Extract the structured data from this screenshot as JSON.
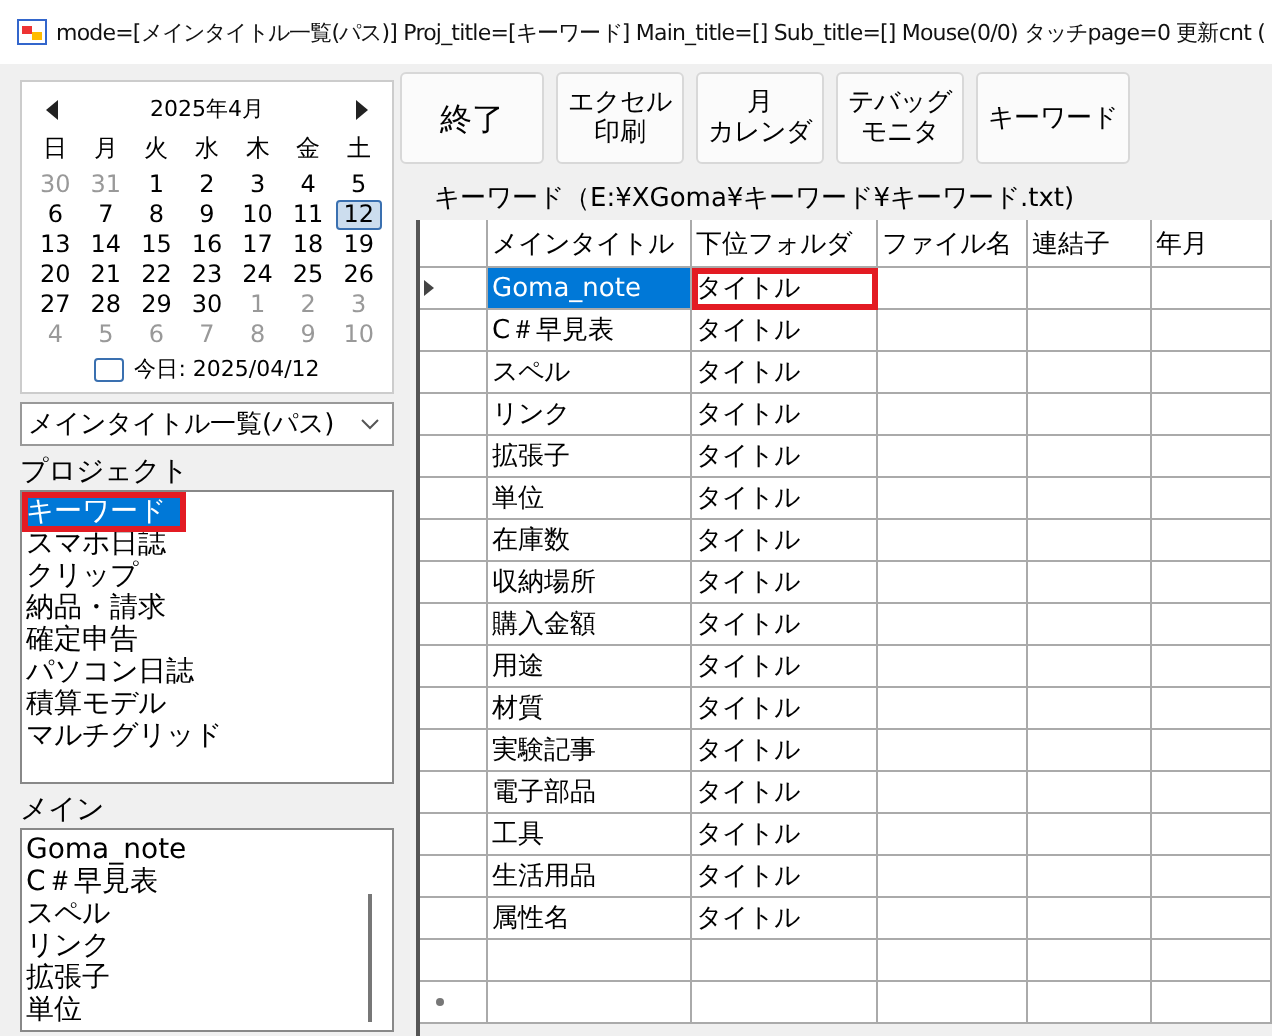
{
  "window": {
    "title": "mode=[メインタイトル一覧(パス)] Proj_title=[キーワード]  Main_title=[]  Sub_title=[]  Mouse(0/0) タッチpage=0 更新cnt ("
  },
  "calendar": {
    "month": "2025年4月",
    "weekdays": [
      "日",
      "月",
      "火",
      "水",
      "木",
      "金",
      "土"
    ],
    "weeks": [
      [
        {
          "day": "30",
          "other": true,
          "selected": false
        },
        {
          "day": "31",
          "other": true,
          "selected": false
        },
        {
          "day": "1",
          "other": false,
          "selected": false
        },
        {
          "day": "2",
          "other": false,
          "selected": false
        },
        {
          "day": "3",
          "other": false,
          "selected": false
        },
        {
          "day": "4",
          "other": false,
          "selected": false
        },
        {
          "day": "5",
          "other": false,
          "selected": false
        }
      ],
      [
        {
          "day": "6",
          "other": false,
          "selected": false
        },
        {
          "day": "7",
          "other": false,
          "selected": false
        },
        {
          "day": "8",
          "other": false,
          "selected": false
        },
        {
          "day": "9",
          "other": false,
          "selected": false
        },
        {
          "day": "10",
          "other": false,
          "selected": false
        },
        {
          "day": "11",
          "other": false,
          "selected": false
        },
        {
          "day": "12",
          "other": false,
          "selected": true
        }
      ],
      [
        {
          "day": "13",
          "other": false,
          "selected": false
        },
        {
          "day": "14",
          "other": false,
          "selected": false
        },
        {
          "day": "15",
          "other": false,
          "selected": false
        },
        {
          "day": "16",
          "other": false,
          "selected": false
        },
        {
          "day": "17",
          "other": false,
          "selected": false
        },
        {
          "day": "18",
          "other": false,
          "selected": false
        },
        {
          "day": "19",
          "other": false,
          "selected": false
        }
      ],
      [
        {
          "day": "20",
          "other": false,
          "selected": false
        },
        {
          "day": "21",
          "other": false,
          "selected": false
        },
        {
          "day": "22",
          "other": false,
          "selected": false
        },
        {
          "day": "23",
          "other": false,
          "selected": false
        },
        {
          "day": "24",
          "other": false,
          "selected": false
        },
        {
          "day": "25",
          "other": false,
          "selected": false
        },
        {
          "day": "26",
          "other": false,
          "selected": false
        }
      ],
      [
        {
          "day": "27",
          "other": false,
          "selected": false
        },
        {
          "day": "28",
          "other": false,
          "selected": false
        },
        {
          "day": "29",
          "other": false,
          "selected": false
        },
        {
          "day": "30",
          "other": false,
          "selected": false
        },
        {
          "day": "1",
          "other": true,
          "selected": false
        },
        {
          "day": "2",
          "other": true,
          "selected": false
        },
        {
          "day": "3",
          "other": true,
          "selected": false
        }
      ],
      [
        {
          "day": "4",
          "other": true,
          "selected": false
        },
        {
          "day": "5",
          "other": true,
          "selected": false
        },
        {
          "day": "6",
          "other": true,
          "selected": false
        },
        {
          "day": "7",
          "other": true,
          "selected": false
        },
        {
          "day": "8",
          "other": true,
          "selected": false
        },
        {
          "day": "9",
          "other": true,
          "selected": false
        },
        {
          "day": "10",
          "other": true,
          "selected": false
        }
      ]
    ],
    "today": "今日: 2025/04/12"
  },
  "mode_dropdown": {
    "value": "メインタイトル一覧(パス)"
  },
  "project_label": "プロジェクト",
  "projects": [
    {
      "label": "キーワード",
      "selected": true,
      "highlighted": true
    },
    {
      "label": "スマホ日誌",
      "selected": false,
      "highlighted": false
    },
    {
      "label": "クリップ",
      "selected": false,
      "highlighted": false
    },
    {
      "label": "納品・請求",
      "selected": false,
      "highlighted": false
    },
    {
      "label": "確定申告",
      "selected": false,
      "highlighted": false
    },
    {
      "label": "パソコン日誌",
      "selected": false,
      "highlighted": false
    },
    {
      "label": "積算モデル",
      "selected": false,
      "highlighted": false
    },
    {
      "label": "マルチグリッド",
      "selected": false,
      "highlighted": false
    }
  ],
  "main_label": "メイン",
  "main_items": [
    "Goma_note",
    "C＃早見表",
    "スペル",
    "リンク",
    "拡張子",
    "単位"
  ],
  "buttons": [
    {
      "lines": [
        "終了"
      ]
    },
    {
      "lines": [
        "エクセル",
        "印刷"
      ]
    },
    {
      "lines": [
        "月",
        "カレンダ"
      ]
    },
    {
      "lines": [
        "テバッグ",
        "モニタ"
      ]
    },
    {
      "lines": [
        "キーワード"
      ]
    }
  ],
  "grid": {
    "path": "キーワード（E:¥XGoma¥キーワード¥キーワード.txt)",
    "columns": [
      "メインタイトル",
      "下位フォルダ",
      "ファイル名",
      "連結子",
      "年月"
    ],
    "rows": [
      {
        "main_title": "Goma_note",
        "subfolder": "タイトル",
        "selected": true,
        "highlighted": true
      },
      {
        "main_title": "C＃早見表",
        "subfolder": "タイトル",
        "selected": false,
        "highlighted": false
      },
      {
        "main_title": "スペル",
        "subfolder": "タイトル",
        "selected": false,
        "highlighted": false
      },
      {
        "main_title": "リンク",
        "subfolder": "タイトル",
        "selected": false,
        "highlighted": false
      },
      {
        "main_title": "拡張子",
        "subfolder": "タイトル",
        "selected": false,
        "highlighted": false
      },
      {
        "main_title": "単位",
        "subfolder": "タイトル",
        "selected": false,
        "highlighted": false
      },
      {
        "main_title": "在庫数",
        "subfolder": "タイトル",
        "selected": false,
        "highlighted": false
      },
      {
        "main_title": "収納場所",
        "subfolder": "タイトル",
        "selected": false,
        "highlighted": false
      },
      {
        "main_title": "購入金額",
        "subfolder": "タイトル",
        "selected": false,
        "highlighted": false
      },
      {
        "main_title": "用途",
        "subfolder": "タイトル",
        "selected": false,
        "highlighted": false
      },
      {
        "main_title": "材質",
        "subfolder": "タイトル",
        "selected": false,
        "highlighted": false
      },
      {
        "main_title": "実験記事",
        "subfolder": "タイトル",
        "selected": false,
        "highlighted": false
      },
      {
        "main_title": "電子部品",
        "subfolder": "タイトル",
        "selected": false,
        "highlighted": false
      },
      {
        "main_title": "工具",
        "subfolder": "タイトル",
        "selected": false,
        "highlighted": false
      },
      {
        "main_title": "生活用品",
        "subfolder": "タイトル",
        "selected": false,
        "highlighted": false
      },
      {
        "main_title": "属性名",
        "subfolder": "タイトル",
        "selected": false,
        "highlighted": false
      }
    ]
  }
}
